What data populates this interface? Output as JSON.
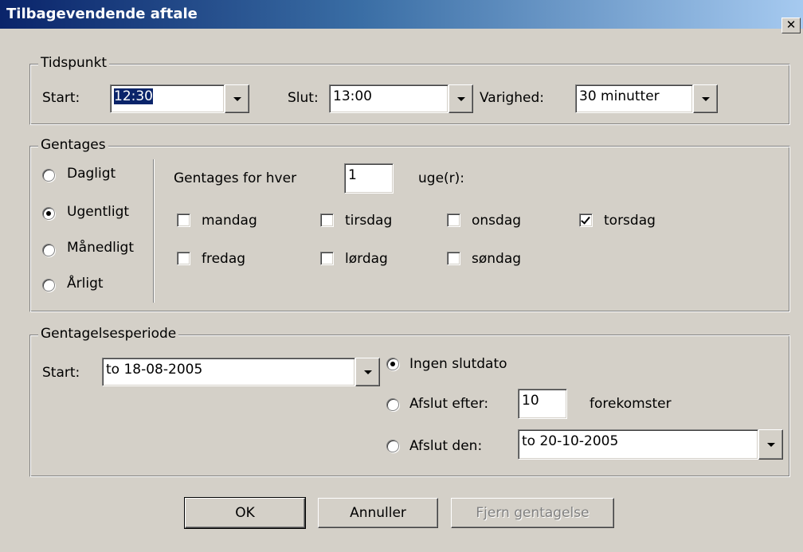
{
  "window": {
    "title": "Tilbagevendende aftale",
    "close_label": "✕"
  },
  "tidspunkt": {
    "legend": "Tidspunkt",
    "start_label": "Start:",
    "start_value": "12:30",
    "slut_label": "Slut:",
    "slut_value": "13:00",
    "varighed_label": "Varighed:",
    "varighed_value": "30 minutter"
  },
  "gentages": {
    "legend": "Gentages",
    "patterns": [
      {
        "label": "Dagligt",
        "selected": false
      },
      {
        "label": "Ugentligt",
        "selected": true
      },
      {
        "label": "Månedligt",
        "selected": false
      },
      {
        "label": "Årligt",
        "selected": false
      }
    ],
    "every_label": "Gentages for hver",
    "every_value": "1",
    "unit_label": "uge(r):",
    "days": [
      {
        "label": "mandag",
        "checked": false
      },
      {
        "label": "tirsdag",
        "checked": false
      },
      {
        "label": "onsdag",
        "checked": false
      },
      {
        "label": "torsdag",
        "checked": true
      },
      {
        "label": "fredag",
        "checked": false
      },
      {
        "label": "lørdag",
        "checked": false
      },
      {
        "label": "søndag",
        "checked": false
      }
    ]
  },
  "periode": {
    "legend": "Gentagelsesperiode",
    "start_label": "Start:",
    "start_value": "to 18-08-2005",
    "end_options": [
      {
        "label": "Ingen slutdato",
        "selected": true
      },
      {
        "label": "Afslut efter:",
        "selected": false
      },
      {
        "label": "Afslut den:",
        "selected": false
      }
    ],
    "occurrences_value": "10",
    "occurrences_unit": "forekomster",
    "end_date_value": "to 20-10-2005"
  },
  "buttons": {
    "ok": "OK",
    "cancel": "Annuller",
    "remove": "Fjern gentagelse"
  }
}
